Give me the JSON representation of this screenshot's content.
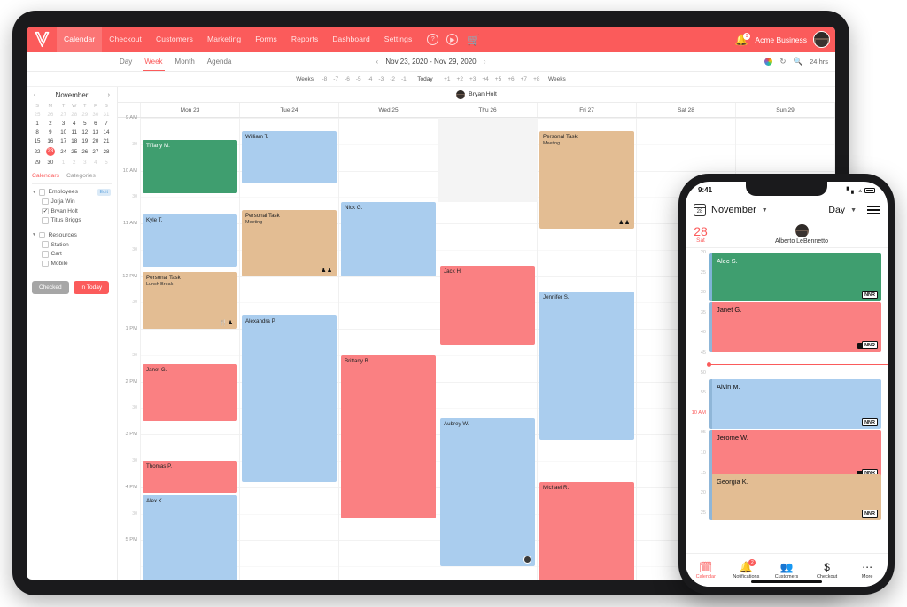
{
  "tablet": {
    "appbar": {
      "logo_icon": "v-logo-icon",
      "nav": [
        {
          "label": "Calendar",
          "active": true
        },
        {
          "label": "Checkout",
          "active": false
        },
        {
          "label": "Customers",
          "active": false
        },
        {
          "label": "Marketing",
          "active": false
        },
        {
          "label": "Forms",
          "active": false
        },
        {
          "label": "Reports",
          "active": false
        },
        {
          "label": "Dashboard",
          "active": false
        },
        {
          "label": "Settings",
          "active": false
        }
      ],
      "help_icon": "question-circle-icon",
      "play_icon": "play-circle-icon",
      "cart_icon": "shopping-cart-icon",
      "bell_icon": "bell-icon",
      "bell_badge": "3",
      "business_name": "Acme Business",
      "avatar": "user-avatar"
    },
    "toolbar": {
      "views": [
        {
          "label": "Day",
          "active": false
        },
        {
          "label": "Week",
          "active": true
        },
        {
          "label": "Month",
          "active": false
        },
        {
          "label": "Agenda",
          "active": false
        }
      ],
      "prev_arrow": "‹",
      "date_range": "Nov 23, 2020 - Nov 29, 2020",
      "next_arrow": "›",
      "color_icon": "color-wheel-icon",
      "refresh_icon": "refresh-icon",
      "search_icon": "search-icon",
      "hours_toggle": "24 hrs"
    },
    "weeks_strip": {
      "left_label": "Weeks",
      "past": [
        "-8",
        "-7",
        "-6",
        "-5",
        "-4",
        "-3",
        "-2",
        "-1"
      ],
      "today": "Today",
      "future": [
        "+1",
        "+2",
        "+3",
        "+4",
        "+5",
        "+6",
        "+7",
        "+8"
      ],
      "right_label": "Weeks"
    },
    "sidebar": {
      "mini_calendar": {
        "prev": "‹",
        "month": "November",
        "next": "›",
        "dow": [
          "S",
          "M",
          "T",
          "W",
          "T",
          "F",
          "S"
        ],
        "weeks": [
          [
            {
              "d": "25",
              "mut": true
            },
            {
              "d": "26",
              "mut": true
            },
            {
              "d": "27",
              "mut": true
            },
            {
              "d": "28",
              "mut": true
            },
            {
              "d": "29",
              "mut": true
            },
            {
              "d": "30",
              "mut": true
            },
            {
              "d": "31",
              "mut": true
            }
          ],
          [
            {
              "d": "1"
            },
            {
              "d": "2"
            },
            {
              "d": "3"
            },
            {
              "d": "4"
            },
            {
              "d": "5"
            },
            {
              "d": "6"
            },
            {
              "d": "7"
            }
          ],
          [
            {
              "d": "8"
            },
            {
              "d": "9"
            },
            {
              "d": "10"
            },
            {
              "d": "11"
            },
            {
              "d": "12"
            },
            {
              "d": "13"
            },
            {
              "d": "14"
            }
          ],
          [
            {
              "d": "15"
            },
            {
              "d": "16"
            },
            {
              "d": "17"
            },
            {
              "d": "18"
            },
            {
              "d": "19"
            },
            {
              "d": "20"
            },
            {
              "d": "21"
            }
          ],
          [
            {
              "d": "22"
            },
            {
              "d": "23",
              "sel": true
            },
            {
              "d": "24"
            },
            {
              "d": "25"
            },
            {
              "d": "26"
            },
            {
              "d": "27"
            },
            {
              "d": "28"
            }
          ],
          [
            {
              "d": "29"
            },
            {
              "d": "30"
            },
            {
              "d": "1",
              "mut": true
            },
            {
              "d": "2",
              "mut": true
            },
            {
              "d": "3",
              "mut": true
            },
            {
              "d": "4",
              "mut": true
            },
            {
              "d": "5",
              "mut": true
            }
          ]
        ]
      },
      "filter_tabs": [
        {
          "label": "Calendars",
          "active": true
        },
        {
          "label": "Categories",
          "active": false
        }
      ],
      "groups": [
        {
          "label": "Employees",
          "checked": false,
          "edit_label": "Edit",
          "items": [
            {
              "label": "Jorja Win",
              "checked": false
            },
            {
              "label": "Bryan Holt",
              "checked": true
            },
            {
              "label": "Titus Briggs",
              "checked": false
            }
          ]
        },
        {
          "label": "Resources",
          "checked": false,
          "items": [
            {
              "label": "Station",
              "checked": false
            },
            {
              "label": "Cart",
              "checked": false
            },
            {
              "label": "Mobile",
              "checked": false
            }
          ]
        }
      ],
      "buttons": [
        {
          "label": "Checked",
          "style": "grey"
        },
        {
          "label": "In Today",
          "style": "red"
        }
      ]
    },
    "calendar": {
      "employee": "Bryan Holt",
      "days": [
        "Mon 23",
        "Tue 24",
        "Wed 25",
        "Thu 26",
        "Fri 27",
        "Sat 28",
        "Sun 29"
      ],
      "hours": [
        "9 AM",
        "10 AM",
        "11 AM",
        "12 PM",
        "1 PM",
        "2 PM",
        "3 PM",
        "4 PM",
        "5 PM"
      ],
      "half_label": "30",
      "events": [
        {
          "day": 0,
          "start": 9.42,
          "end": 10.42,
          "title": "Tiffany M.",
          "sub": "",
          "color": "green",
          "icons": ""
        },
        {
          "day": 0,
          "start": 10.83,
          "end": 11.83,
          "title": "Kyle T.",
          "sub": "",
          "color": "blue",
          "icons": ""
        },
        {
          "day": 0,
          "start": 11.92,
          "end": 13.0,
          "title": "Personal Task",
          "sub": "Lunch Break",
          "color": "tan",
          "icons": "🍴♟"
        },
        {
          "day": 0,
          "start": 13.67,
          "end": 14.75,
          "title": "Janet G.",
          "sub": "",
          "color": "red",
          "icons": ""
        },
        {
          "day": 0,
          "start": 15.5,
          "end": 16.1,
          "title": "Thomas P.",
          "sub": "",
          "color": "red",
          "icons": ""
        },
        {
          "day": 0,
          "start": 16.15,
          "end": 18.0,
          "title": "Alex K.",
          "sub": "",
          "color": "blue",
          "icons": ""
        },
        {
          "day": 1,
          "start": 9.25,
          "end": 10.25,
          "title": "William T.",
          "sub": "",
          "color": "blue",
          "icons": ""
        },
        {
          "day": 1,
          "start": 10.75,
          "end": 12.0,
          "title": "Personal Task",
          "sub": "Meeting",
          "color": "tan",
          "icons": "♟♟"
        },
        {
          "day": 1,
          "start": 12.75,
          "end": 15.9,
          "title": "Alexandra P.",
          "sub": "",
          "color": "blue",
          "icons": ""
        },
        {
          "day": 2,
          "start": 10.6,
          "end": 12.0,
          "title": "Nick G.",
          "sub": "",
          "color": "blue",
          "icons": ""
        },
        {
          "day": 2,
          "start": 13.5,
          "end": 16.6,
          "title": "Brittany B.",
          "sub": "",
          "color": "red",
          "icons": ""
        },
        {
          "day": 3,
          "start": 11.8,
          "end": 13.3,
          "title": "Jack H.",
          "sub": "",
          "color": "red",
          "icons": ""
        },
        {
          "day": 3,
          "start": 14.7,
          "end": 17.5,
          "title": "Aubrey W.",
          "sub": "",
          "color": "blue",
          "icons": "clock"
        },
        {
          "day": 4,
          "start": 9.25,
          "end": 11.1,
          "title": "Personal Task",
          "sub": "Meeting",
          "color": "tan",
          "icons": "♟♟"
        },
        {
          "day": 4,
          "start": 12.3,
          "end": 15.1,
          "title": "Jennifer S.",
          "sub": "",
          "color": "blue",
          "icons": ""
        },
        {
          "day": 4,
          "start": 15.9,
          "end": 18.2,
          "title": "Michael R.",
          "sub": "",
          "color": "red",
          "icons": ""
        }
      ]
    }
  },
  "phone": {
    "status": {
      "time": "9:41",
      "signal_icon": "cellular-icon",
      "wifi_icon": "wifi-icon",
      "battery_icon": "battery-icon"
    },
    "header": {
      "calendar_icon": "calendar-icon",
      "calendar_icon_day": "28",
      "month": "November",
      "view": "Day",
      "menu_icon": "hamburger-menu-icon"
    },
    "subheader": {
      "day_number": "28",
      "day_name": "Sat",
      "person": "Alberto LeBennetto",
      "avatar": "user-avatar"
    },
    "minute_ticks": [
      "20",
      "25",
      "30",
      "35",
      "40",
      "45",
      "50",
      "55",
      "10 AM",
      "05",
      "10",
      "15",
      "20",
      "25"
    ],
    "events": [
      {
        "title": "Alec S.",
        "color": "green",
        "badge": "NNR",
        "square": false
      },
      {
        "title": "Janet G.",
        "color": "red",
        "badge": "NNR",
        "square": true
      },
      {
        "title": "Alvin M.",
        "color": "blue",
        "badge": "NNR",
        "square": false
      },
      {
        "title": "Jerome W.",
        "color": "red",
        "badge": "NNR",
        "square": true
      },
      {
        "title": "Georgia K.",
        "color": "tan",
        "badge": "NNR",
        "square": false
      }
    ],
    "tabs": [
      {
        "label": "Calendar",
        "icon": "calendar-icon",
        "active": true,
        "badge": ""
      },
      {
        "label": "Notifications",
        "icon": "bell-icon",
        "active": false,
        "badge": "2"
      },
      {
        "label": "Customers",
        "icon": "people-icon",
        "active": false,
        "badge": ""
      },
      {
        "label": "Checkout",
        "icon": "dollar-icon",
        "active": false,
        "badge": ""
      },
      {
        "label": "More",
        "icon": "ellipsis-icon",
        "active": false,
        "badge": ""
      }
    ]
  }
}
